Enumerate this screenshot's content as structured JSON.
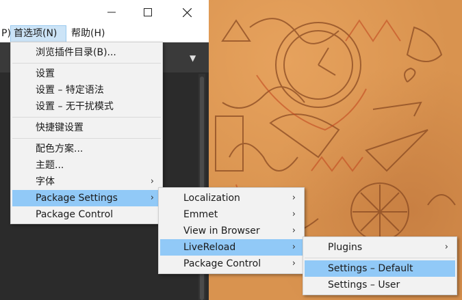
{
  "menubar": {
    "partial_label": "P)",
    "preferences_label": "首选项(N)",
    "help_label": "帮助(H)"
  },
  "preferences_menu": {
    "items": [
      {
        "label": "浏览插件目录(B)..."
      },
      {
        "label": "设置"
      },
      {
        "label": "设置 – 特定语法"
      },
      {
        "label": "设置 – 无干扰模式"
      },
      {
        "label": "快捷键设置"
      },
      {
        "label": "配色方案..."
      },
      {
        "label": "主题..."
      },
      {
        "label": "字体",
        "submenu": true
      },
      {
        "label": "Package Settings",
        "submenu": true,
        "highlighted": true
      },
      {
        "label": "Package Control"
      }
    ]
  },
  "package_settings_menu": {
    "items": [
      {
        "label": "Localization",
        "submenu": true
      },
      {
        "label": "Emmet",
        "submenu": true
      },
      {
        "label": "View in Browser",
        "submenu": true
      },
      {
        "label": "LiveReload",
        "submenu": true,
        "highlighted": true
      },
      {
        "label": "Package Control",
        "submenu": true
      }
    ]
  },
  "livereload_menu": {
    "items": [
      {
        "label": "Plugins",
        "submenu": true
      },
      {
        "label": "Settings – Default",
        "highlighted": true
      },
      {
        "label": "Settings – User"
      }
    ]
  },
  "icons": {
    "submenu_arrow": "›",
    "tab_dropdown": "▼"
  },
  "colors": {
    "highlight": "#91c9f7",
    "menu_bg": "#f2f2f2",
    "editor_bg": "#2b2b2b",
    "wallpaper": "#d9934f"
  }
}
